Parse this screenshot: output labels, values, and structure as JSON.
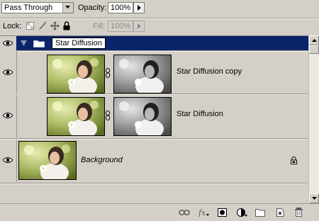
{
  "blend_mode": {
    "value": "Pass Through"
  },
  "opacity": {
    "label": "Opacity:",
    "value": "100%"
  },
  "lock": {
    "label": "Lock:"
  },
  "fill": {
    "label": "Fill:",
    "value": "100%"
  },
  "group": {
    "name": "Star Diffusion"
  },
  "layers": [
    {
      "name": "Star Diffusion copy"
    },
    {
      "name": "Star Diffusion"
    },
    {
      "name": "Background"
    }
  ],
  "colors": {
    "selection": "#0a246a",
    "panel": "#d4d0c8"
  }
}
